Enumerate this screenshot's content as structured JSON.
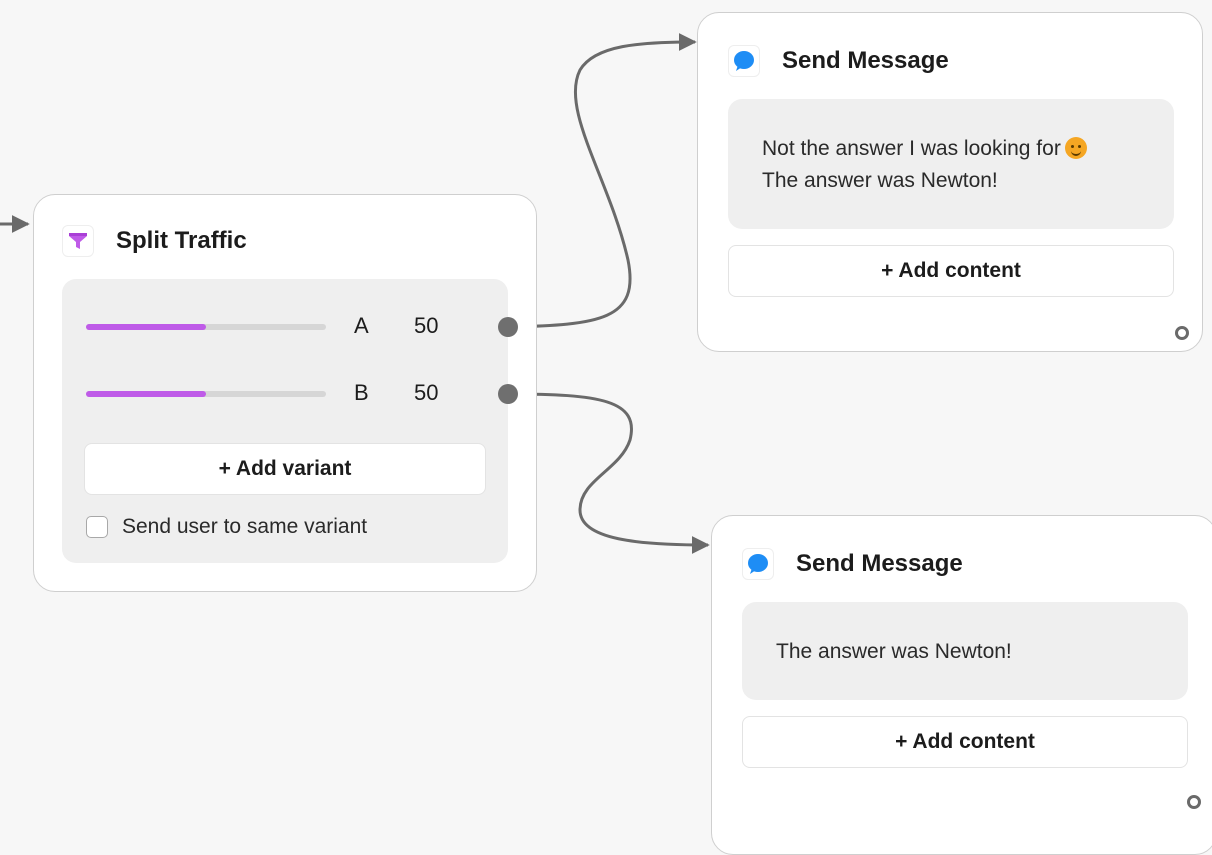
{
  "split_node": {
    "title": "Split Traffic",
    "icon": "funnel-icon",
    "accent_color": "#bf5be8",
    "variants": [
      {
        "label": "A",
        "value": "50",
        "fill_percent": 50
      },
      {
        "label": "B",
        "value": "50",
        "fill_percent": 50
      }
    ],
    "add_variant_label": "+ Add variant",
    "same_variant_label": "Send user to same variant",
    "same_variant_checked": false
  },
  "message_nodes": [
    {
      "title": "Send Message",
      "icon": "chat-bubble-icon",
      "lines": [
        "Not the answer I was looking for",
        "The answer was Newton!"
      ],
      "add_content_label": "+ Add content"
    },
    {
      "title": "Send Message",
      "icon": "chat-bubble-icon",
      "lines": [
        "The answer was Newton!"
      ],
      "add_content_label": "+ Add content"
    }
  ],
  "colors": {
    "canvas": "#f7f7f7",
    "edge": "#6a6a6a",
    "message_icon": "#1e8df5"
  }
}
